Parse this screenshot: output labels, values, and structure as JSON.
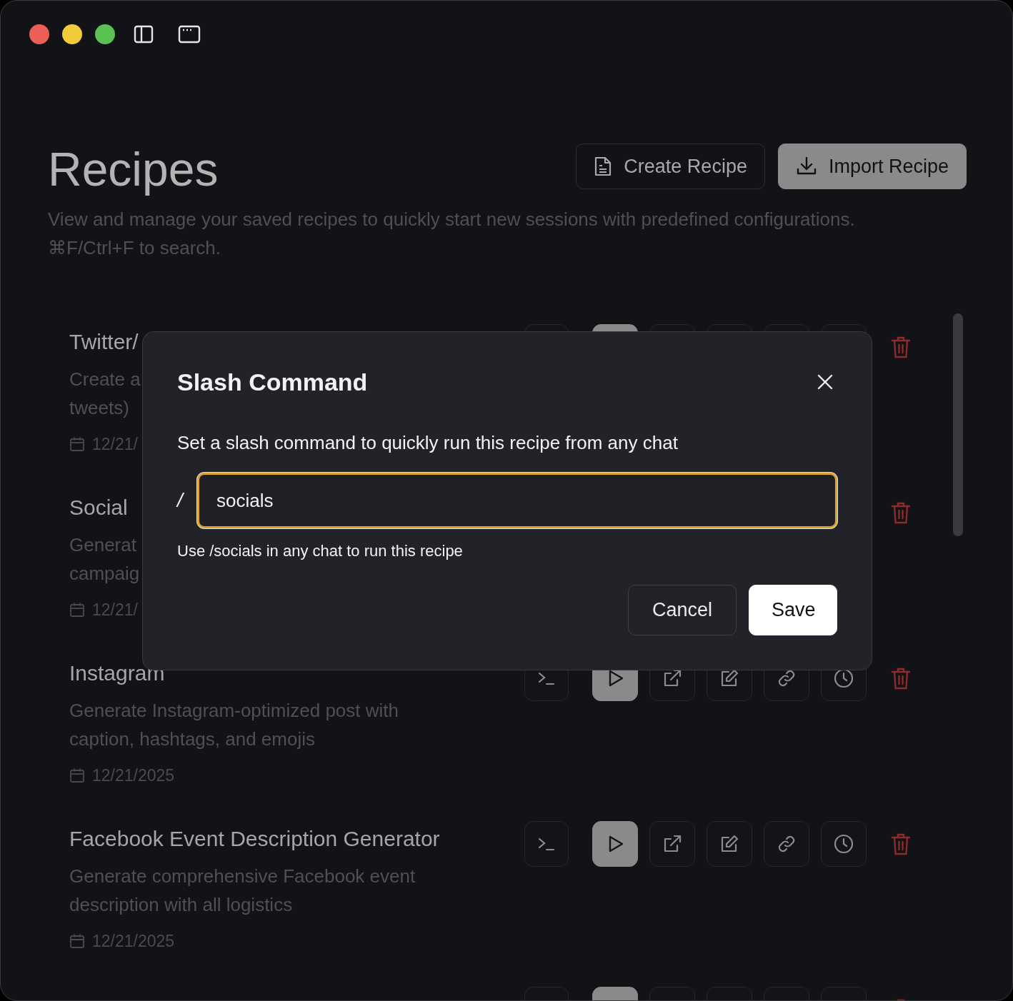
{
  "window": {
    "traffic_lights": [
      {
        "color": "#ec5f57"
      },
      {
        "color": "#f1cb3a"
      },
      {
        "color": "#5bc152"
      }
    ]
  },
  "header": {
    "title": "Recipes",
    "buttons": [
      {
        "label": "Create Recipe",
        "kind": "create"
      },
      {
        "label": "Import Recipe",
        "kind": "import"
      }
    ],
    "description": [
      "View and manage your saved recipes to quickly start new sessions with predefined configurations.",
      "⌘F/Ctrl+F to search."
    ]
  },
  "recipes": [
    {
      "kind": "clipped",
      "title": "Twitter/",
      "description": [
        "Create a",
        "tweets)"
      ],
      "date": "12/21/"
    },
    {
      "kind": "covered",
      "title": "Social",
      "description": [
        "Generat",
        "campaig"
      ],
      "date": "12/21/"
    },
    {
      "kind": "recipe",
      "title": "Instagram",
      "description": [
        "Generate Instagram-optimized post with",
        "caption, hashtags, and emojis"
      ],
      "date": "12/21/2025"
    },
    {
      "kind": "recipe",
      "title": "Facebook Event Description Generator",
      "description": [
        "Generate comprehensive Facebook event",
        "description with all logistics"
      ],
      "date": "12/21/2025"
    },
    {
      "kind": "clipped"
    }
  ],
  "dialog": {
    "title": "Slash Command",
    "text": "Set a slash command to quickly run this recipe from any chat",
    "prefix": "/",
    "value": "socials",
    "hint": "Use /socials in any chat to run this recipe",
    "buttons": [
      {
        "label": "Cancel",
        "kind": "secondary"
      },
      {
        "label": "Save",
        "kind": "primary"
      }
    ]
  }
}
